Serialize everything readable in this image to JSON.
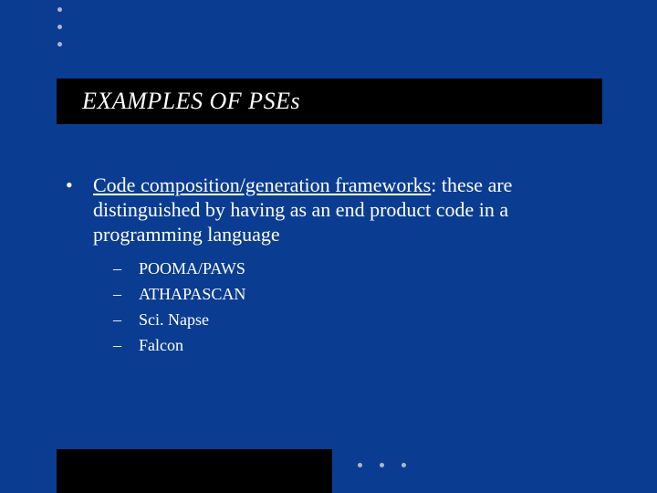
{
  "title": "EXAMPLES OF PSEs",
  "main_bullet": {
    "marker": "•",
    "lead_text": "Code composition/generation frameworks",
    "rest_text": ": these are distinguished by having as an end product code in a programming language"
  },
  "sub_bullets": {
    "marker": "–",
    "items": [
      "POOMA/PAWS",
      "ATHAPASCAN",
      "Sci. Napse",
      "Falcon"
    ]
  }
}
